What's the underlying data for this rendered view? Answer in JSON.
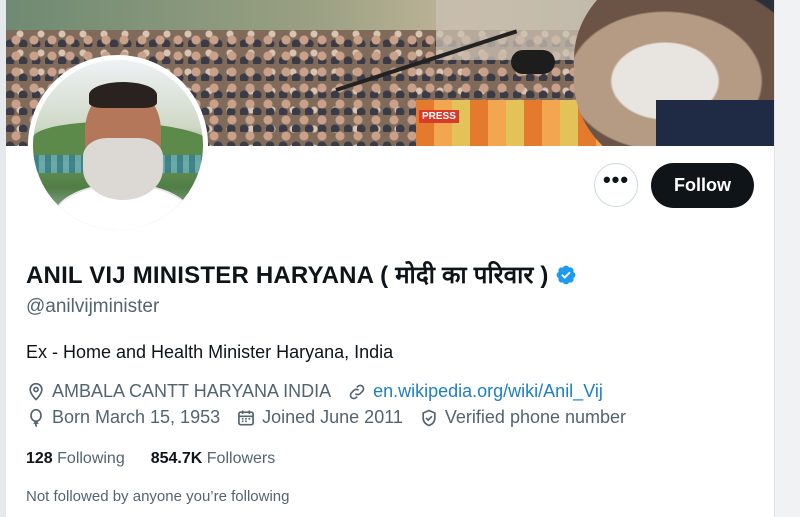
{
  "profile": {
    "display_name": "ANIL VIJ MINISTER HARYANA ( मोदी का परिवार )",
    "handle": "@anilvijminister",
    "bio": "Ex - Home and Health Minister Haryana, India",
    "location": "AMBALA CANTT HARYANA INDIA",
    "website": "en.wikipedia.org/wiki/Anil_Vij",
    "born": "Born March 15, 1953",
    "joined": "Joined June 2011",
    "verified_phone": "Verified phone number",
    "verified_badge_color": "#1d9bf0"
  },
  "stats": {
    "following_count": "128",
    "following_label": "Following",
    "followers_count": "854.7K",
    "followers_label": "Followers"
  },
  "followed_by_text": "Not followed by anyone you’re following",
  "actions": {
    "more_label": "•••",
    "follow_label": "Follow"
  },
  "banner": {
    "press_sign": "PRESS"
  },
  "icons": {
    "location": "location-pin-icon",
    "link": "link-icon",
    "born": "balloon-icon",
    "joined": "calendar-icon",
    "verified_phone": "shield-check-icon",
    "verified": "verified-badge-icon"
  }
}
